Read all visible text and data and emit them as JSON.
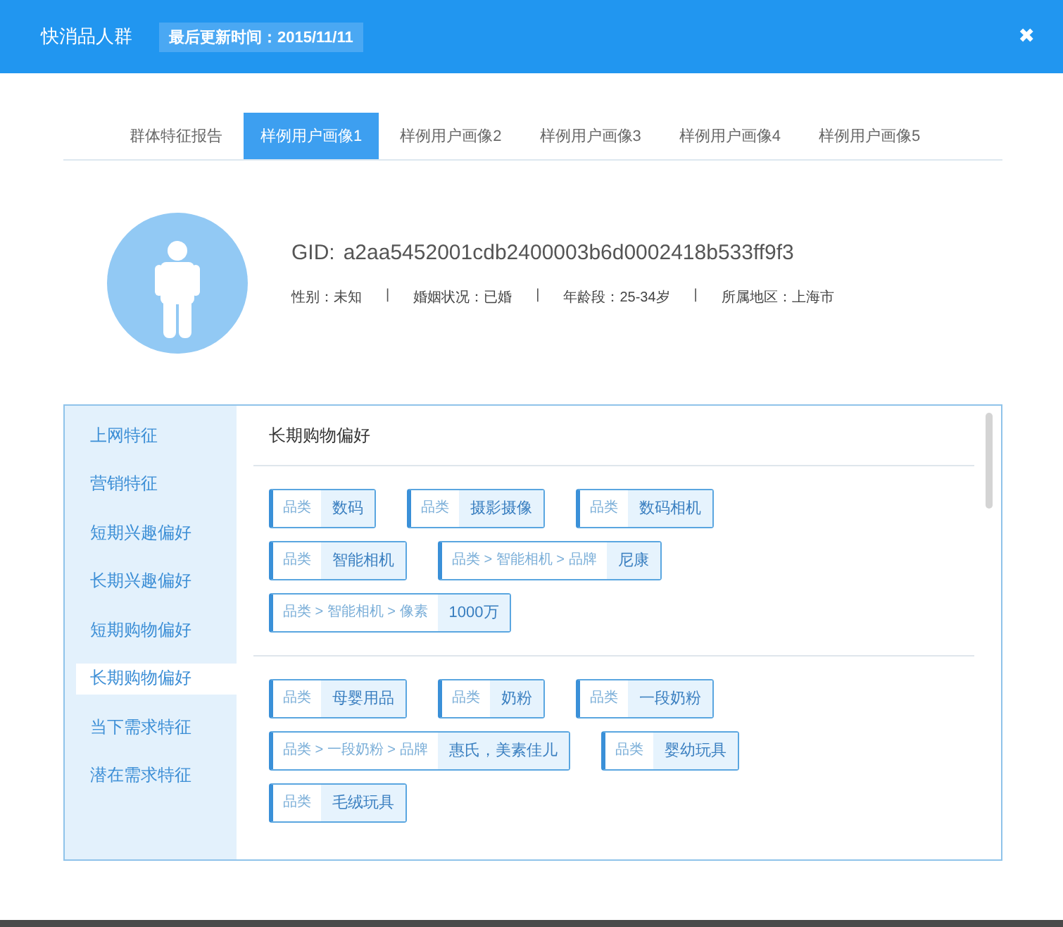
{
  "window": {
    "title": "快消品人群",
    "updated": "最后更新时间：2015/11/11",
    "close": "✖"
  },
  "tabs": [
    {
      "label": "群体特征报告",
      "selected": false
    },
    {
      "label": "样例用户画像1",
      "selected": true
    },
    {
      "label": "样例用户画像2",
      "selected": false
    },
    {
      "label": "样例用户画像3",
      "selected": false
    },
    {
      "label": "样例用户画像4",
      "selected": false
    },
    {
      "label": "样例用户画像5",
      "selected": false
    }
  ],
  "profile": {
    "gid_label": "GID:",
    "gid": "a2aa5452001cdb2400003b6d0002418b533ff9f3",
    "attributes": [
      "性别：未知",
      "婚姻状况：已婚",
      "年龄段：25-34岁",
      "所属地区：上海市"
    ],
    "separators": [
      "|",
      "|",
      "|"
    ]
  },
  "sidebar": {
    "items": [
      {
        "label": "上网特征",
        "selected": false
      },
      {
        "label": "营销特征",
        "selected": false
      },
      {
        "label": "短期兴趣偏好",
        "selected": false
      },
      {
        "label": "长期兴趣偏好",
        "selected": false
      },
      {
        "label": "短期购物偏好",
        "selected": false
      },
      {
        "label": "长期购物偏好",
        "selected": true
      },
      {
        "label": "当下需求特征",
        "selected": false
      },
      {
        "label": "潜在需求特征",
        "selected": false
      }
    ]
  },
  "content": {
    "title": "长期购物偏好",
    "groups": [
      {
        "tags": [
          {
            "key": "品类",
            "value": "数码"
          },
          {
            "key": "品类",
            "value": "摄影摄像"
          },
          {
            "key": "品类",
            "value": "数码相机"
          },
          {
            "key": "品类",
            "value": "智能相机"
          },
          {
            "key": "品类 > 智能相机 > 品牌",
            "value": "尼康"
          },
          {
            "key": "品类 > 智能相机 > 像素",
            "value": "1000万"
          }
        ]
      },
      {
        "tags": [
          {
            "key": "品类",
            "value": "母婴用品"
          },
          {
            "key": "品类",
            "value": "奶粉"
          },
          {
            "key": "品类",
            "value": "一段奶粉"
          },
          {
            "key": "品类 > 一段奶粉 > 品牌",
            "value": "惠氏，美素佳儿"
          },
          {
            "key": "品类",
            "value": "婴幼玩具"
          },
          {
            "key": "品类",
            "value": "毛绒玩具"
          }
        ]
      }
    ]
  }
}
